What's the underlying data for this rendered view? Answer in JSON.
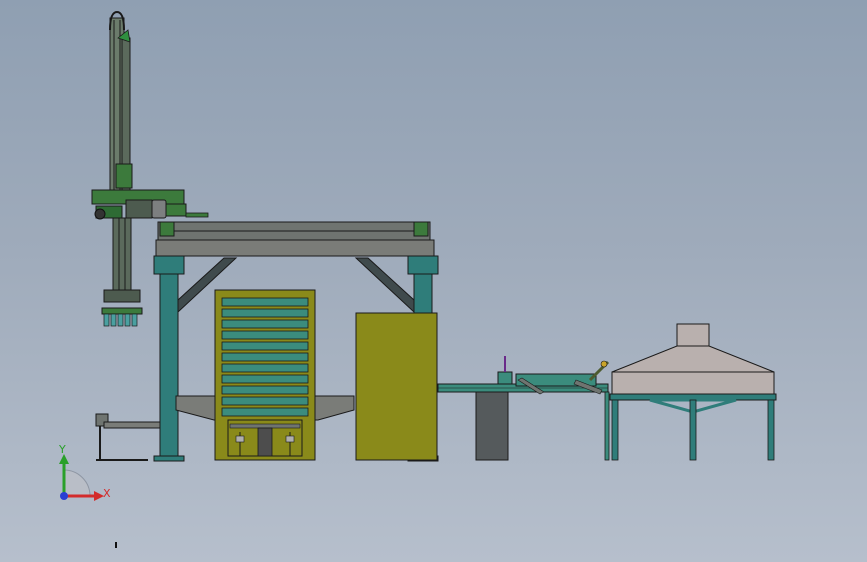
{
  "viewport": {
    "background_top": "#8f9fb2",
    "background_bottom": "#b6bfcc"
  },
  "triad": {
    "x_label": "X",
    "y_label": "Y",
    "x_color": "#d32b2b",
    "y_color": "#2aa02a",
    "z_color": "#2a3fd3"
  },
  "colors": {
    "frame_teal": "#2f7d7a",
    "beam_gray": "#6f7470",
    "press_olive": "#8a8a1a",
    "plate_teal": "#3b8c7d",
    "robot_green": "#3c7a3c",
    "hood_gray": "#b9b0ae",
    "block_dark": "#555a5c"
  }
}
